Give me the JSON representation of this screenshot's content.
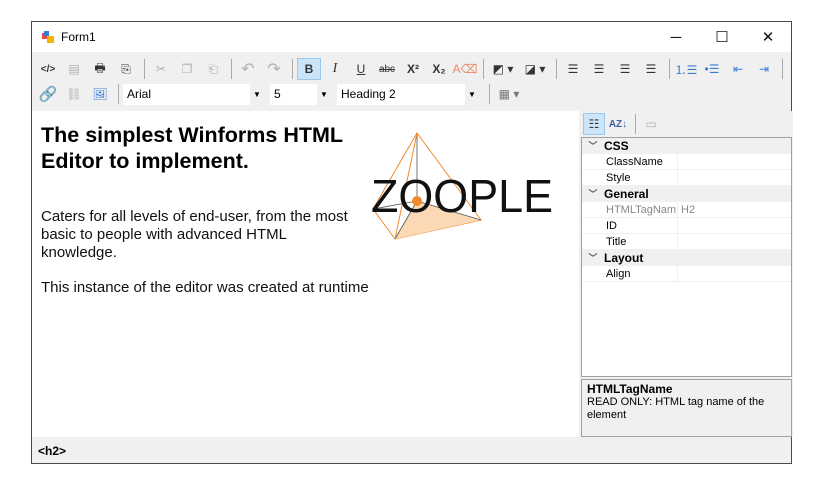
{
  "window": {
    "title": "Form1",
    "minimize": "─",
    "maximize": "☐",
    "close": "✕"
  },
  "toolbar": {
    "font": "Arial",
    "size": "5",
    "format": "Heading 2",
    "bold": "B",
    "italic": "I",
    "underline": "U",
    "strike": "abc",
    "superscript": "X²",
    "subscript": "X₂"
  },
  "editor": {
    "heading": "The simplest Winforms HTML Editor to implement.",
    "para1": "Caters for all levels of end-user, from the most basic to people with advanced HTML knowledge.",
    "para2": "This instance of the editor was created at runtime",
    "logo_text": "ZOOPLE",
    "colors": {
      "logo_orange": "#f08a2c",
      "logo_fill": "#fbd9b5"
    }
  },
  "properties": {
    "categories": [
      {
        "name": "CSS",
        "rows": [
          {
            "key": "ClassName",
            "value": ""
          },
          {
            "key": "Style",
            "value": ""
          }
        ]
      },
      {
        "name": "General",
        "rows": [
          {
            "key": "HTMLTagNam",
            "value": "H2"
          },
          {
            "key": "ID",
            "value": ""
          },
          {
            "key": "Title",
            "value": ""
          }
        ]
      },
      {
        "name": "Layout",
        "rows": [
          {
            "key": "Align",
            "value": ""
          }
        ]
      }
    ],
    "description_title": "HTMLTagName",
    "description_text": "READ ONLY: HTML tag name of the element"
  },
  "status": {
    "tag": "<h2>"
  }
}
